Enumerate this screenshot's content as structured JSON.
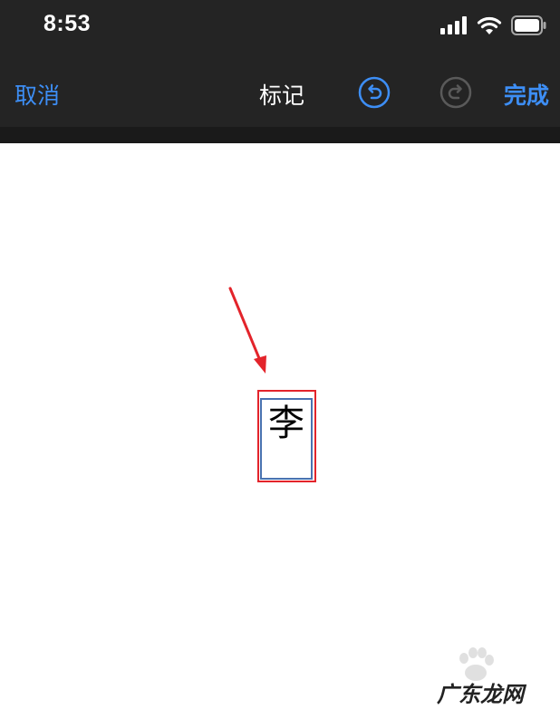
{
  "status": {
    "time": "8:53"
  },
  "nav": {
    "cancel_label": "取消",
    "title": "标记",
    "done_label": "完成"
  },
  "canvas": {
    "character": "李"
  },
  "watermark": {
    "text": "广东龙网"
  },
  "colors": {
    "accent": "#3d8ef5",
    "bar_background": "#242424",
    "annotation_red": "#e3242b",
    "text_box_blue": "#4a72b0"
  }
}
